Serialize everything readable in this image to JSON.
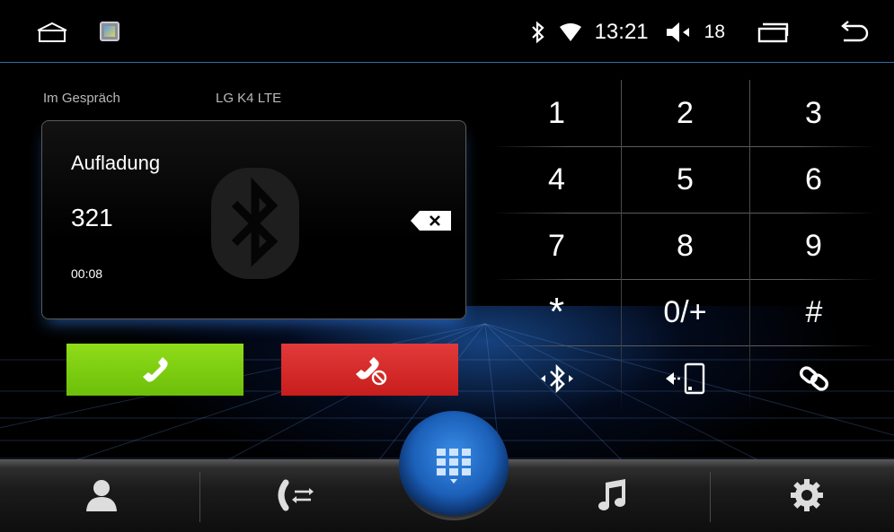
{
  "status_bar": {
    "time": "13:21",
    "volume": "18",
    "icons": [
      "home-icon",
      "app-thumbnail-icon",
      "bluetooth-icon",
      "wifi-icon",
      "volume-icon",
      "recent-apps-icon",
      "back-icon"
    ]
  },
  "call": {
    "status": "Im Gespräch",
    "device": "LG K4 LTE",
    "name": "Aufladung",
    "number": "321",
    "duration": "00:08"
  },
  "buttons": {
    "answer_icon": "phone-answer-icon",
    "hangup_icon": "phone-hangup-icon",
    "answer_color": "#7ccc12",
    "hangup_color": "#d42a2a"
  },
  "keypad": {
    "keys": [
      "1",
      "2",
      "3",
      "4",
      "5",
      "6",
      "7",
      "8",
      "9",
      "*",
      "0/+",
      "#"
    ],
    "action_icons": [
      "bluetooth-audio-icon",
      "transfer-to-phone-icon",
      "link-icon"
    ]
  },
  "dock": {
    "items": [
      "contacts-icon",
      "call-log-icon",
      "dialpad-icon",
      "music-icon",
      "settings-icon"
    ],
    "accent": "#2f7fdc"
  }
}
